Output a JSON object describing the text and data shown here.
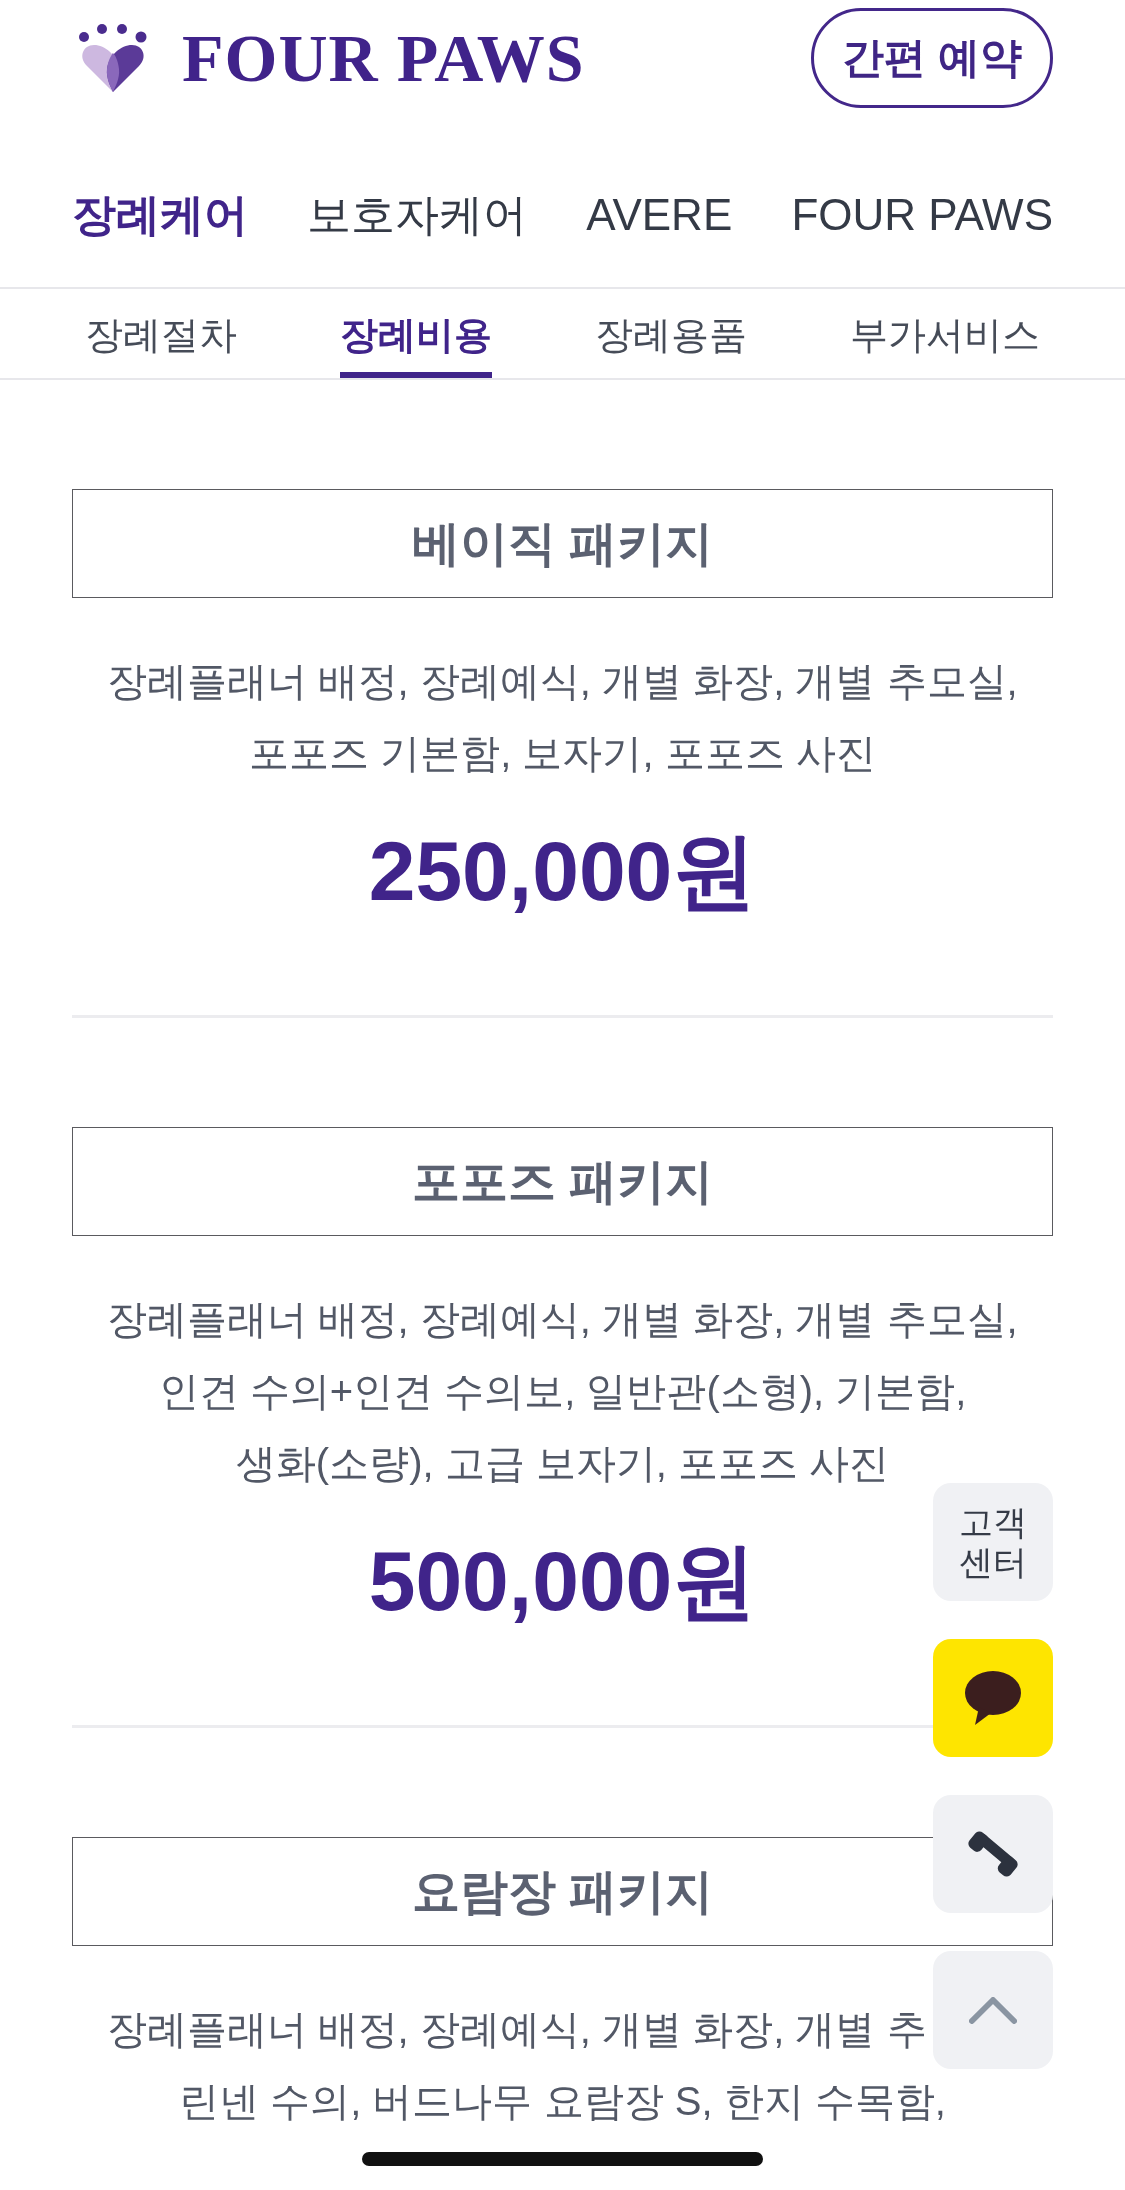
{
  "header": {
    "logo_text": "FOUR PAWS",
    "booking_button": "간편 예약"
  },
  "main_tabs": [
    {
      "label": "장례케어",
      "selected": true
    },
    {
      "label": "보호자케어",
      "selected": false
    },
    {
      "label": "AVERE",
      "selected": false
    },
    {
      "label": "FOUR PAWS",
      "selected": false
    }
  ],
  "sub_tabs": [
    {
      "label": "장례절차",
      "selected": false
    },
    {
      "label": "장례비용",
      "selected": true
    },
    {
      "label": "장례용품",
      "selected": false
    },
    {
      "label": "부가서비스",
      "selected": false
    }
  ],
  "packages": [
    {
      "title": "베이직 패키지",
      "description": [
        "장례플래너 배정, 장례예식, 개별 화장, 개별 추모실,",
        "포포즈 기본함, 보자기, 포포즈 사진"
      ],
      "price": "250,000원"
    },
    {
      "title": "포포즈 패키지",
      "description": [
        "장례플래너 배정, 장례예식, 개별 화장, 개별 추모실,",
        "인견 수의+인견 수의보, 일반관(소형), 기본함,",
        "생화(소량), 고급 보자기, 포포즈 사진"
      ],
      "price": "500,000원"
    },
    {
      "title": "요람장 패키지",
      "description": [
        "장례플래너 배정, 장례예식, 개별 화장, 개별 추",
        "린넨 수의, 버드나무 요람장 S, 한지 수목함,"
      ]
    }
  ],
  "floating_buttons": [
    {
      "kind": "label",
      "label": "고객 센터"
    },
    {
      "kind": "chat"
    },
    {
      "kind": "phone"
    },
    {
      "kind": "top"
    }
  ]
}
